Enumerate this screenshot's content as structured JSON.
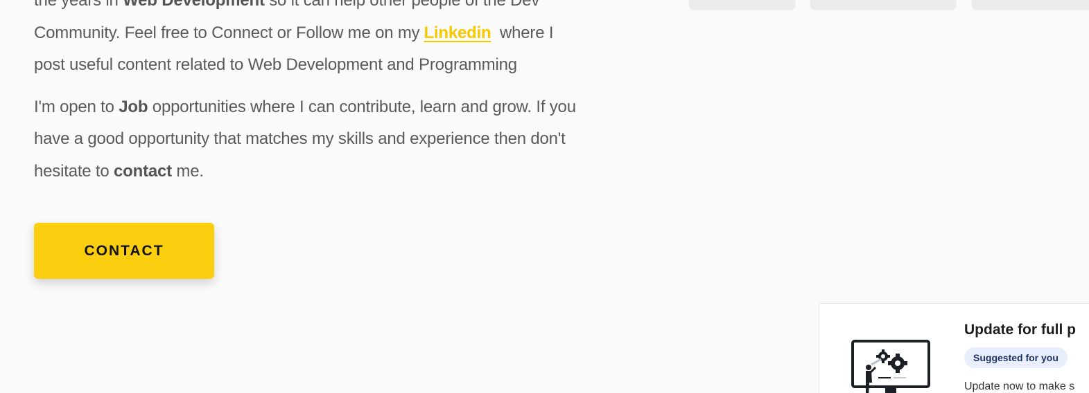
{
  "about": {
    "p1_frag_before": "the years in ",
    "p1_strong": "Web Development",
    "p1_frag_mid": " so it can help other people of the Dev Community. Feel free to Connect or Follow me on my",
    "p1_link": "Linkedin",
    "p1_frag_after": " where I post useful content related to Web Development and Programming",
    "p2_before": "I'm open to ",
    "p2_job": "Job",
    "p2_mid": " opportunities where I can contribute, learn and grow. If you have a good opportunity that matches my skills and experience then don't hesitate to ",
    "p2_contact": "contact",
    "p2_after": " me."
  },
  "contact_button": {
    "label": "CONTACT"
  },
  "update_card": {
    "title": "Update for full p",
    "badge": "Suggested for you",
    "description": "Update now to make s",
    "illustration": "monitor-gears-icon"
  },
  "colors": {
    "background": "#fafafa",
    "accent": "#fbcf10",
    "link": "#f7c800",
    "text": "#5a5a5a",
    "badge_bg": "#e8eefb",
    "badge_text": "#1d2f5f"
  }
}
